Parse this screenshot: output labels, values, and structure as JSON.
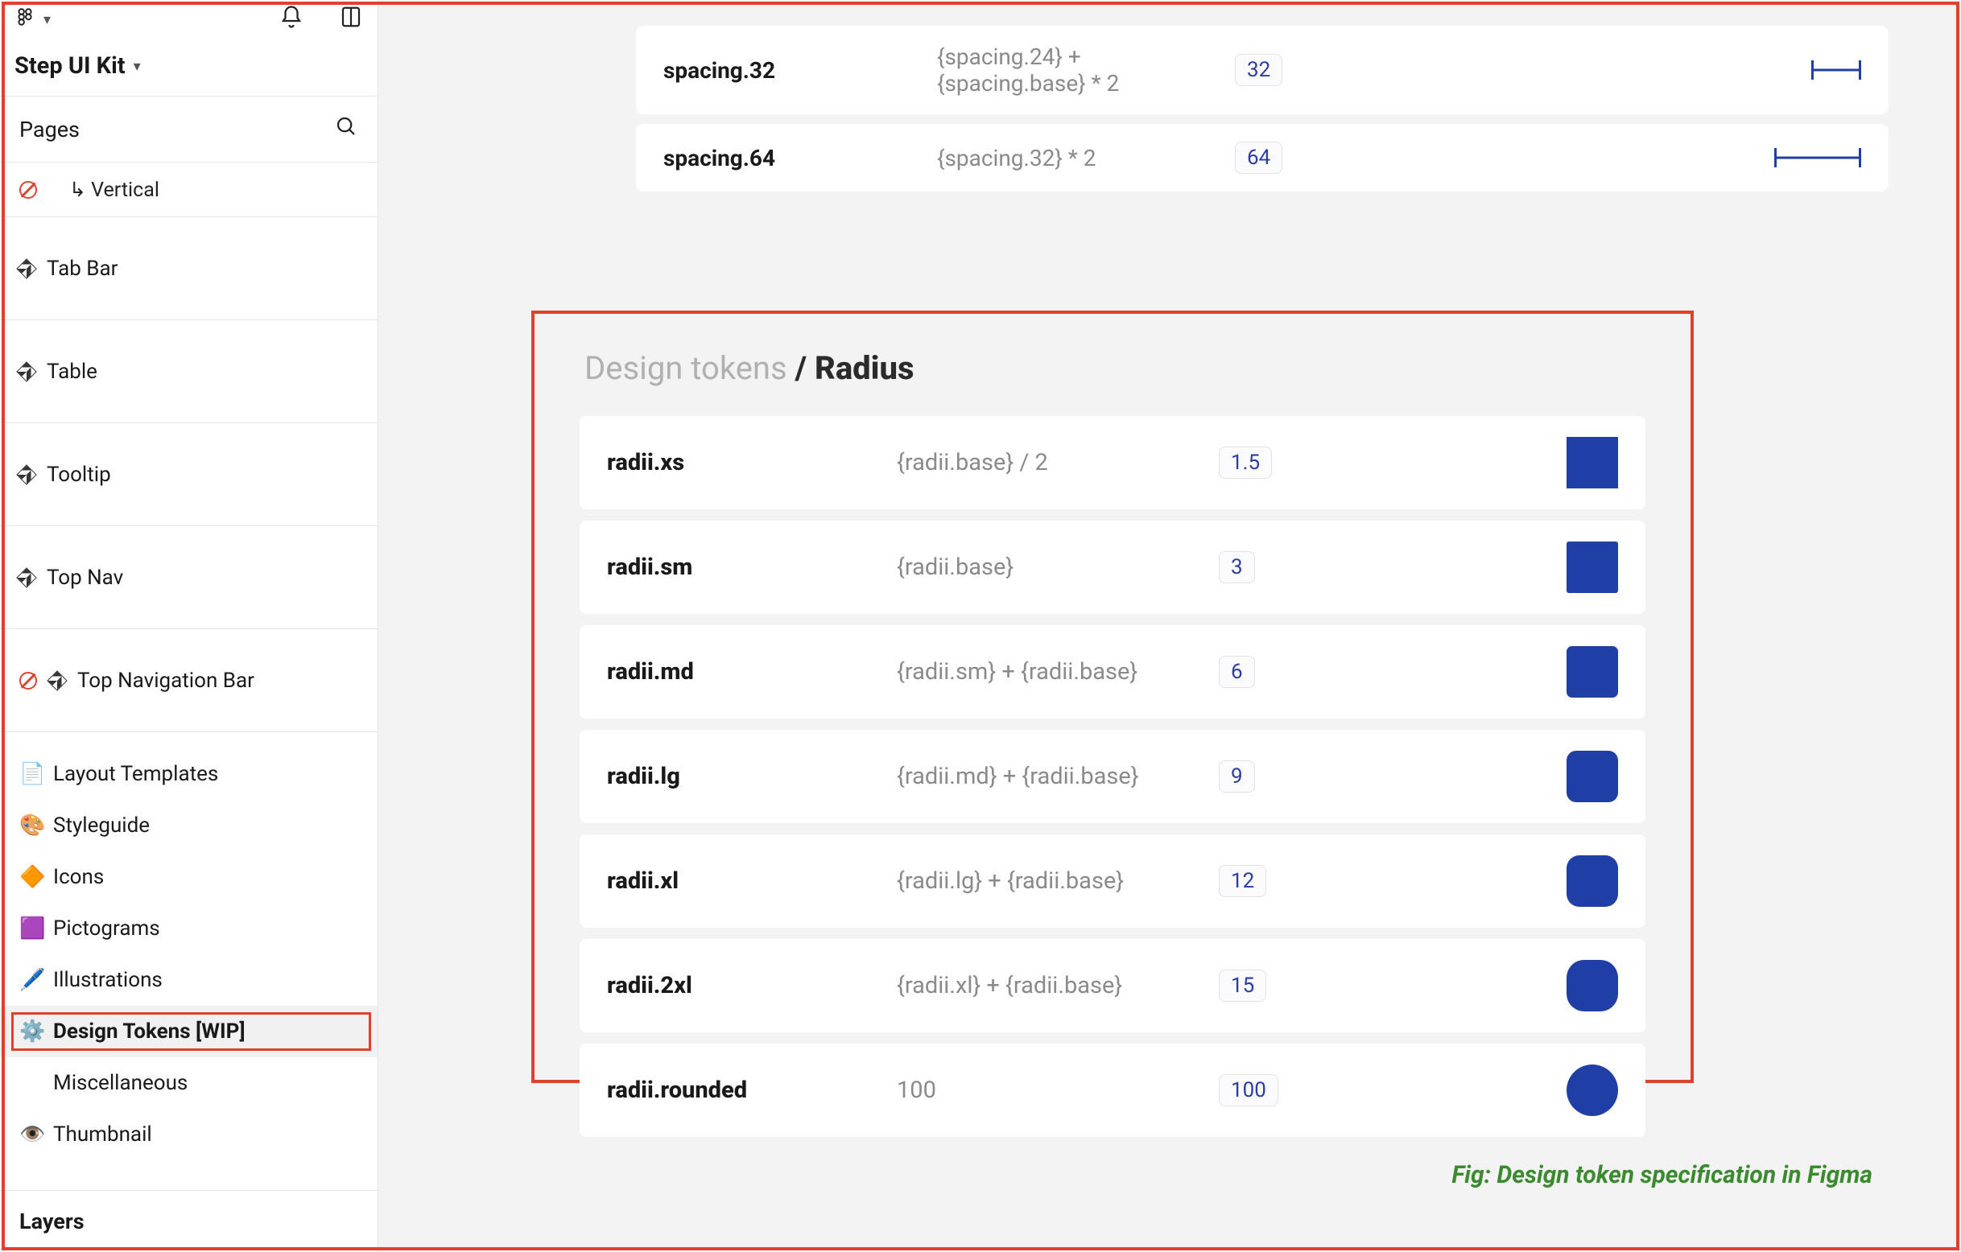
{
  "header": {
    "file_name": "Step UI Kit",
    "pages_label": "Pages",
    "layers_label": "Layers"
  },
  "sidebar": {
    "vertical_label": "Vertical",
    "components": [
      {
        "label": "Tab Bar",
        "noentry": false
      },
      {
        "label": "Table",
        "noentry": false
      },
      {
        "label": "Tooltip",
        "noentry": false
      },
      {
        "label": "Top Nav",
        "noentry": false
      },
      {
        "label": "Top Navigation Bar",
        "noentry": true
      }
    ],
    "code_badge": "</>",
    "pages": [
      {
        "emoji": "📄",
        "label": "Layout Templates"
      },
      {
        "emoji": "🎨",
        "label": "Styleguide"
      },
      {
        "emoji": "🔶",
        "label": "Icons"
      },
      {
        "emoji": "🟪",
        "label": "Pictograms"
      },
      {
        "emoji": "🖊️",
        "label": "Illustrations"
      },
      {
        "emoji": "⚙️",
        "label": "Design Tokens [WIP]",
        "selected": true
      },
      {
        "emoji": "",
        "label": "Miscellaneous"
      },
      {
        "emoji": "👁️",
        "label": "Thumbnail"
      }
    ]
  },
  "spacing_tail": [
    {
      "name": "spacing.32",
      "expr": "{spacing.24} + {spacing.base} * 2",
      "value": "32",
      "ruler_w": 62
    },
    {
      "name": "spacing.64",
      "expr": "{spacing.32} * 2",
      "value": "64",
      "ruler_w": 108
    }
  ],
  "radius": {
    "title_muted": "Design tokens ",
    "title_bold": "/ Radius",
    "rows": [
      {
        "name": "radii.xs",
        "expr": "{radii.base} / 2",
        "value": "1.5",
        "radius": 0
      },
      {
        "name": "radii.sm",
        "expr": "{radii.base}",
        "value": "3",
        "radius": 3
      },
      {
        "name": "radii.md",
        "expr": "{radii.sm} + {radii.base}",
        "value": "6",
        "radius": 7
      },
      {
        "name": "radii.lg",
        "expr": "{radii.md} + {radii.base}",
        "value": "9",
        "radius": 12
      },
      {
        "name": "radii.xl",
        "expr": "{radii.lg} + {radii.base}",
        "value": "12",
        "radius": 16
      },
      {
        "name": "radii.2xl",
        "expr": "{radii.xl} + {radii.base}",
        "value": "15",
        "radius": 22
      },
      {
        "name": "radii.rounded",
        "expr": "100",
        "value": "100",
        "radius": 999
      }
    ]
  },
  "caption": "Fig: Design token specification in Figma",
  "colors": {
    "accent": "#1f3fa6",
    "highlight": "#e0412f"
  }
}
